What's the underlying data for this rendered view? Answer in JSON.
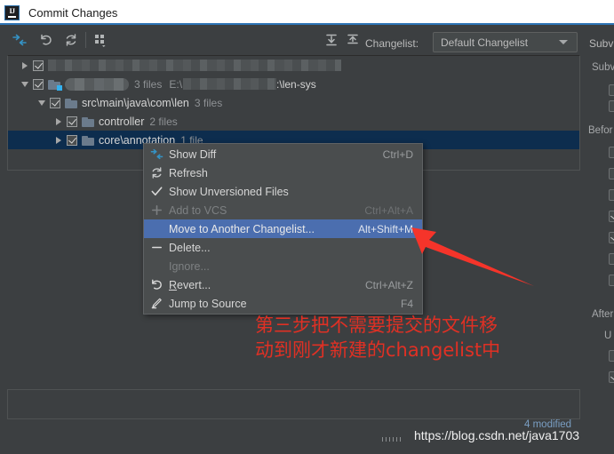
{
  "window": {
    "title": "Commit Changes",
    "icon": "intellij-idea-icon"
  },
  "toolbar": {
    "icons": [
      {
        "name": "show-diff-icon",
        "glyph": "diff"
      },
      {
        "name": "revert-icon",
        "glyph": "undo"
      },
      {
        "name": "refresh-icon",
        "glyph": "refresh"
      },
      {
        "name": "group-by-icon",
        "glyph": "grid"
      },
      {
        "name": "expand-all-icon",
        "glyph": "expand"
      },
      {
        "name": "collapse-all-icon",
        "glyph": "collapse"
      }
    ],
    "changelist_label": "Changelist:",
    "changelist_value": "Default Changelist",
    "subversion_label": "Subv"
  },
  "tree": {
    "rows": [
      {
        "indent": 0,
        "twisty": "right",
        "checked": true,
        "folder": false,
        "redacted": true,
        "redact_width": 330,
        "label": "",
        "count": "",
        "selected": false
      },
      {
        "indent": 0,
        "twisty": "down",
        "checked": true,
        "folder": true,
        "folder_badge": true,
        "redacted": true,
        "redact_width": 70,
        "label": "",
        "count": "3 files",
        "path_prefix": "E:\\",
        "path_redact_width": 105,
        "path_suffix": ":\\len-sys",
        "selected": false
      },
      {
        "indent": 1,
        "twisty": "down",
        "checked": true,
        "folder": true,
        "label": "src\\main\\java\\com\\len",
        "count": "3 files",
        "selected": false
      },
      {
        "indent": 2,
        "twisty": "right",
        "checked": true,
        "folder": true,
        "label": "controller",
        "count": "2 files",
        "selected": false
      },
      {
        "indent": 2,
        "twisty": "right",
        "checked": true,
        "folder": true,
        "label": "core\\annotation",
        "count": "1 file",
        "selected": true
      }
    ]
  },
  "context_menu": {
    "items": [
      {
        "icon": "show-diff-icon",
        "label": "Show Diff",
        "accel": "Ctrl+D",
        "state": "normal"
      },
      {
        "icon": "refresh-icon",
        "label": "Refresh",
        "accel": "",
        "state": "normal"
      },
      {
        "icon": "check-icon",
        "label": "Show Unversioned Files",
        "accel": "",
        "state": "normal"
      },
      {
        "icon": "plus-icon",
        "label": "Add to VCS",
        "accel": "Ctrl+Alt+A",
        "state": "disabled"
      },
      {
        "icon": "none",
        "label": "Move to Another Changelist...",
        "accel": "Alt+Shift+M",
        "state": "highlight"
      },
      {
        "icon": "minus-icon",
        "label": "Delete...",
        "accel": "",
        "state": "normal"
      },
      {
        "icon": "none",
        "label": "Ignore...",
        "accel": "",
        "state": "disabled"
      },
      {
        "icon": "revert-icon",
        "label": "Revert...",
        "accel": "Ctrl+Alt+Z",
        "state": "normal",
        "mnemonic": "R"
      },
      {
        "icon": "jump-to-source-icon",
        "label": "Jump to Source",
        "accel": "F4",
        "state": "normal"
      }
    ]
  },
  "options_panel": {
    "sections": [
      {
        "label": "Subv"
      },
      {
        "label": "Befor"
      },
      {
        "label": "After"
      },
      {
        "label": "U"
      }
    ]
  },
  "annotation": {
    "line1": "第三步把不需要提交的文件移",
    "line2": "动到刚才新建的changelist中",
    "color": "#e03024",
    "arrow": "red-arrow-pointer"
  },
  "status": {
    "modified": "4 modified",
    "watermark": "https://blog.csdn.net/java1703"
  }
}
